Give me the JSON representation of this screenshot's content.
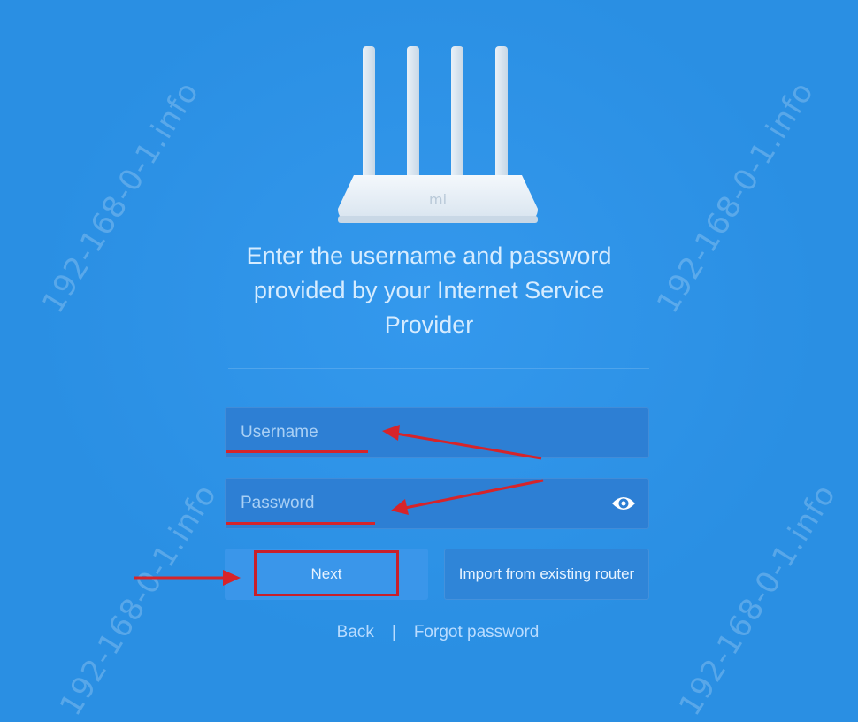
{
  "watermark": "192-168-0-1.info",
  "router": {
    "logo": "mi"
  },
  "heading": {
    "line1": "Enter the username and password",
    "line2": "provided by your Internet Service",
    "line3": "Provider"
  },
  "form": {
    "username_placeholder": "Username",
    "password_placeholder": "Password"
  },
  "buttons": {
    "next_label": "Next",
    "import_label": "Import from existing router"
  },
  "footer": {
    "back_label": "Back",
    "separator": "|",
    "forgot_label": "Forgot password"
  },
  "icons": {
    "password_toggle": "eye-icon"
  },
  "colors": {
    "background": "#2a8fe3",
    "annotation_red": "#d6242a"
  }
}
